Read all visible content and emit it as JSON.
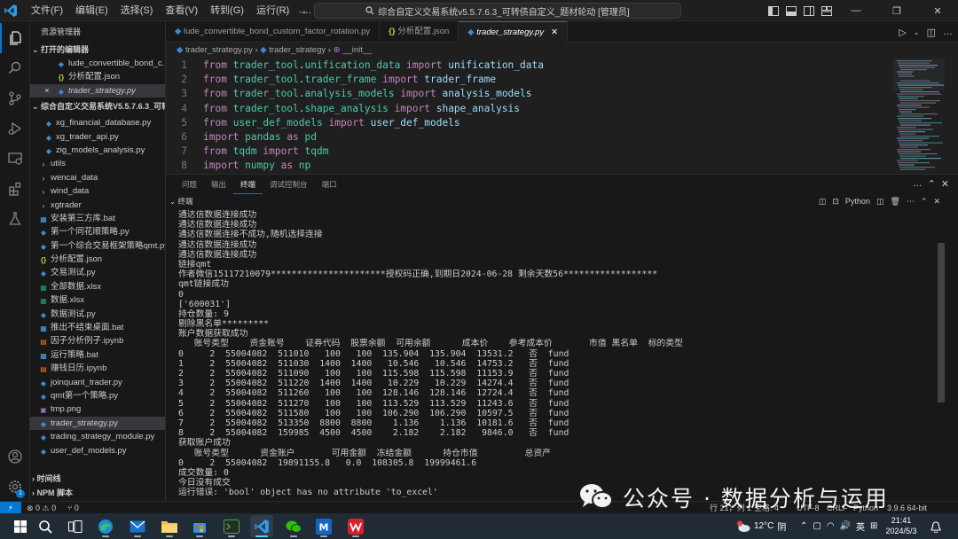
{
  "titlebar": {
    "menu": [
      "文件(F)",
      "编辑(E)",
      "选择(S)",
      "查看(V)",
      "转到(G)",
      "运行(R)",
      "…"
    ],
    "search": "综合自定义交易系统v5.5.7.6.3_可转债自定义_题材轮动 [管理员]"
  },
  "sidebar": {
    "header": "资源管理器",
    "open_editors_title": "打开的编辑器",
    "open_editors": [
      {
        "name": "lude_convertible_bond_c...",
        "type": "py"
      },
      {
        "name": "分析配置.json",
        "type": "json"
      },
      {
        "name": "trader_strategy.py",
        "type": "py",
        "close": "×"
      }
    ],
    "workspace_title": "综合自定义交易系统V5.5.7.6.3_可转...",
    "files": [
      {
        "name": "xg_financial_database.py",
        "type": "py",
        "indent": 2
      },
      {
        "name": "xg_trader_api.py",
        "type": "py",
        "indent": 2
      },
      {
        "name": "zig_models_analysis.py",
        "type": "py",
        "indent": 2
      },
      {
        "name": "utils",
        "type": "folder",
        "indent": 1
      },
      {
        "name": "wencai_data",
        "type": "folder",
        "indent": 1
      },
      {
        "name": "wind_data",
        "type": "folder",
        "indent": 1
      },
      {
        "name": "xgtrader",
        "type": "folder",
        "indent": 1
      },
      {
        "name": "安装第三方库.bat",
        "type": "bat",
        "indent": 1
      },
      {
        "name": "第一个同花顺策略.py",
        "type": "py",
        "indent": 1
      },
      {
        "name": "第一个综合交易框架策略qmt.py",
        "type": "py",
        "indent": 1
      },
      {
        "name": "分析配置.json",
        "type": "json",
        "indent": 1
      },
      {
        "name": "交易测试.py",
        "type": "py",
        "indent": 1
      },
      {
        "name": "全部数据.xlsx",
        "type": "xlsx",
        "indent": 1
      },
      {
        "name": "数据.xlsx",
        "type": "xlsx",
        "indent": 1
      },
      {
        "name": "数据测试.py",
        "type": "py",
        "indent": 1
      },
      {
        "name": "推出不结束桌面.bat",
        "type": "bat",
        "indent": 1
      },
      {
        "name": "因子分析例子.ipynb",
        "type": "ipynb",
        "indent": 1
      },
      {
        "name": "运行策略.bat",
        "type": "bat",
        "indent": 1
      },
      {
        "name": "赚钱日历.ipynb",
        "type": "ipynb",
        "indent": 1
      },
      {
        "name": "joinquant_trader.py",
        "type": "py",
        "indent": 1
      },
      {
        "name": "qmt第一个策略.py",
        "type": "py",
        "indent": 1
      },
      {
        "name": "tmp.png",
        "type": "png",
        "indent": 1
      },
      {
        "name": "trader_strategy.py",
        "type": "py",
        "indent": 1,
        "selected": true
      },
      {
        "name": "trading_strategy_module.py",
        "type": "py",
        "indent": 1
      },
      {
        "name": "user_def_models.py",
        "type": "py",
        "indent": 1
      }
    ],
    "bottom_sections": [
      "时间线",
      "NPM 脚本"
    ]
  },
  "tabs": [
    {
      "label": "lude_convertible_bond_custom_factor_rotation.py",
      "type": "py"
    },
    {
      "label": "分析配置.json",
      "type": "json"
    },
    {
      "label": "trader_strategy.py",
      "type": "py",
      "active": true
    }
  ],
  "breadcrumb": {
    "file": "trader_strategy.py",
    "class": "trader_strategy",
    "method": "__init__"
  },
  "editor": {
    "lines": [
      {
        "n": "1",
        "tokens": [
          [
            "kw",
            "from "
          ],
          [
            "mod",
            "trader_tool"
          ],
          [
            "id",
            "."
          ],
          [
            "mod",
            "unification_data"
          ],
          [
            "kw",
            " import "
          ],
          [
            "id",
            "unification_data"
          ]
        ]
      },
      {
        "n": "2",
        "tokens": [
          [
            "kw",
            "from "
          ],
          [
            "mod",
            "trader_tool"
          ],
          [
            "id",
            "."
          ],
          [
            "mod",
            "trader_frame"
          ],
          [
            "kw",
            " import "
          ],
          [
            "id",
            "trader_frame"
          ]
        ]
      },
      {
        "n": "3",
        "tokens": [
          [
            "kw",
            "from "
          ],
          [
            "mod",
            "trader_tool"
          ],
          [
            "id",
            "."
          ],
          [
            "mod",
            "analysis_models"
          ],
          [
            "kw",
            " import "
          ],
          [
            "id",
            "analysis_models"
          ]
        ]
      },
      {
        "n": "4",
        "tokens": [
          [
            "kw",
            "from "
          ],
          [
            "mod",
            "trader_tool"
          ],
          [
            "id",
            "."
          ],
          [
            "mod",
            "shape_analysis"
          ],
          [
            "kw",
            " import "
          ],
          [
            "id",
            "shape_analysis"
          ]
        ]
      },
      {
        "n": "5",
        "tokens": [
          [
            "kw",
            "from "
          ],
          [
            "mod",
            "user_def_models"
          ],
          [
            "kw",
            " import "
          ],
          [
            "id",
            "user_def_models"
          ]
        ]
      },
      {
        "n": "6",
        "tokens": [
          [
            "kw",
            "import "
          ],
          [
            "mod",
            "pandas"
          ],
          [
            "kw",
            " as "
          ],
          [
            "mod",
            "pd"
          ]
        ]
      },
      {
        "n": "7",
        "tokens": [
          [
            "kw",
            "from "
          ],
          [
            "mod",
            "tqdm"
          ],
          [
            "kw",
            " import "
          ],
          [
            "mod",
            "tqdm"
          ]
        ]
      },
      {
        "n": "8",
        "tokens": [
          [
            "kw",
            "import "
          ],
          [
            "mod",
            "numpy"
          ],
          [
            "kw",
            " as "
          ],
          [
            "mod",
            "np"
          ]
        ]
      }
    ]
  },
  "panel": {
    "tabs": [
      "问题",
      "输出",
      "终端",
      "调试控制台",
      "端口"
    ],
    "active_tab": "终端",
    "terminal_label": "终端",
    "shell": "Python"
  },
  "terminal": [
    "通达信数据连接成功",
    "通达信数据连接成功",
    "通达信数据连接不成功,随机选择连接",
    "通达信数据连接成功",
    "通达信数据连接成功",
    "链接qmt",
    "作者微信15117210079**********************授权码正确,到期日2024-06-28 剩余天数56******************",
    "qmt链接成功",
    "0",
    "['600031']",
    "持仓数量: 9",
    "剔除黑名单*********",
    "账户数据获取成功",
    "   账号类型    资金账号    证券代码  股票余额  可用余额      成本价    参考成本价       市值 黑名单  标的类型",
    "0     2  55004082  511010   100   100  135.904  135.904  13531.2   否  fund",
    "1     2  55004082  511030  1400  1400   10.546   10.546  14753.2   否  fund",
    "2     2  55004082  511090   100   100  115.598  115.598  11153.9   否  fund",
    "3     2  55004082  511220  1400  1400   10.229   10.229  14274.4   否  fund",
    "4     2  55004082  511260   100   100  128.146  128.146  12724.4   否  fund",
    "5     2  55004082  511270   100   100  113.529  113.529  11243.6   否  fund",
    "6     2  55004082  511580   100   100  106.290  106.290  10597.5   否  fund",
    "7     2  55004082  513350  8800  8800    1.136    1.136  10181.6   否  fund",
    "8     2  55004082  159985  4500  4500    2.182    2.182   9846.0   否  fund",
    "获取账户成功",
    "   账号类型      资金账户       可用金额  冻结金额      持仓市值         总资产",
    "0     2  55004082  19891155.8   0.0  108305.8  19999461.6",
    "成交数量: 0",
    "今日没有成交",
    "运行错误: 'bool' object has no attribute 'to_excel'"
  ],
  "statusbar": {
    "remote": "⚡",
    "problems": "⊗ 0 ⚠ 0",
    "ports": "⑂ 0",
    "cursor": "行 21，列 1",
    "spaces": "空格: 4",
    "encoding": "UTF-8",
    "eol": "CRLF",
    "lang": "Python",
    "version": "3.9.6 64-bit"
  },
  "watermark": {
    "text": "公众号 · 数据分析与运用"
  },
  "taskbar": {
    "weather_temp": "12°C",
    "weather_desc": "阴",
    "ime": "英",
    "time": "21:41",
    "date": "2024/5/3"
  }
}
